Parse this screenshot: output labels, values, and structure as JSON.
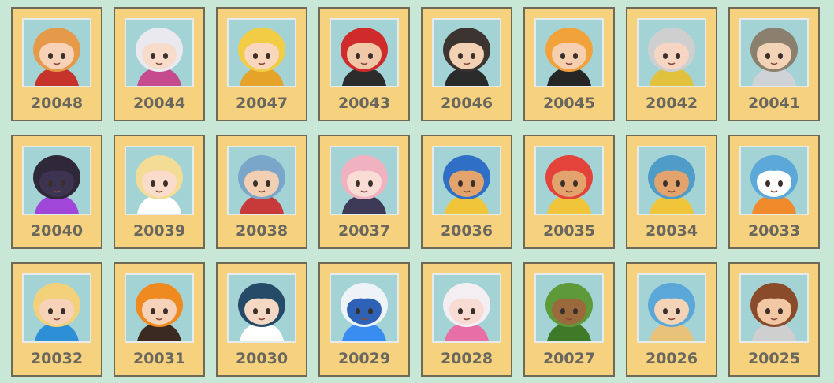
{
  "grid": {
    "items": [
      {
        "id": "20048",
        "icon": "chibi-girl-orange-hair-icon",
        "hair": "#e59a4a",
        "skin": "#f7d2b7",
        "accent": "#c5332a"
      },
      {
        "id": "20044",
        "icon": "chibi-white-hair-cap-icon",
        "hair": "#e9e9ef",
        "skin": "#f8dccb",
        "accent": "#c54a8e"
      },
      {
        "id": "20047",
        "icon": "chibi-yellow-costume-icon",
        "hair": "#f2cc45",
        "skin": "#f9d7bd",
        "accent": "#e6a32a"
      },
      {
        "id": "20043",
        "icon": "chibi-red-armor-icon",
        "hair": "#cf2b2b",
        "skin": "#f0c8a8",
        "accent": "#2c2c2c"
      },
      {
        "id": "20046",
        "icon": "chibi-dark-hat-boy-icon",
        "hair": "#3b3431",
        "skin": "#f2d1b5",
        "accent": "#2a2a2a"
      },
      {
        "id": "20045",
        "icon": "chibi-orange-ninja-icon",
        "hair": "#f1a23b",
        "skin": "#f6cfb0",
        "accent": "#262626"
      },
      {
        "id": "20042",
        "icon": "chibi-silver-hair-eyepatch-icon",
        "hair": "#cfcfcf",
        "skin": "#f6d6c3",
        "accent": "#e2c13c"
      },
      {
        "id": "20041",
        "icon": "chibi-armored-knight-icon",
        "hair": "#8b7f6e",
        "skin": "#f2d3b8",
        "accent": "#cfd2d6"
      },
      {
        "id": "20040",
        "icon": "chibi-dark-robot-icon",
        "hair": "#2e2838",
        "skin": "#3c3450",
        "accent": "#a047d9"
      },
      {
        "id": "20039",
        "icon": "chibi-blonde-laurel-icon",
        "hair": "#f3dc96",
        "skin": "#f9ddca",
        "accent": "#ffffff"
      },
      {
        "id": "20038",
        "icon": "chibi-armored-general-icon",
        "hair": "#7aa6c9",
        "skin": "#f2cfb2",
        "accent": "#c83a3a"
      },
      {
        "id": "20037",
        "icon": "chibi-pink-hair-girl-icon",
        "hair": "#f0b1c0",
        "skin": "#f9dcd3",
        "accent": "#3c3a56"
      },
      {
        "id": "20036",
        "icon": "chibi-blue-fish-hood-icon",
        "hair": "#2f6fc5",
        "skin": "#e2a36c",
        "accent": "#f0c53a"
      },
      {
        "id": "20035",
        "icon": "chibi-red-fish-hood-icon",
        "hair": "#e3433a",
        "skin": "#e2a36c",
        "accent": "#f0c53a"
      },
      {
        "id": "20034",
        "icon": "chibi-teal-fish-hood-icon",
        "hair": "#4e9cc7",
        "skin": "#e2a36c",
        "accent": "#f0c53a"
      },
      {
        "id": "20033",
        "icon": "chibi-snowman-icon",
        "hair": "#5ba8d9",
        "skin": "#ffffff",
        "accent": "#f08a2a"
      },
      {
        "id": "20032",
        "icon": "chibi-mermaid-blonde-icon",
        "hair": "#f3d07a",
        "skin": "#f6d2b8",
        "accent": "#2d8fd6"
      },
      {
        "id": "20031",
        "icon": "chibi-pumpkin-head-icon",
        "hair": "#ef8a20",
        "skin": "#f6d2b8",
        "accent": "#3b2a20"
      },
      {
        "id": "20030",
        "icon": "chibi-dark-hair-white-rabbit-icon",
        "hair": "#264b68",
        "skin": "#f4d8c4",
        "accent": "#ffffff"
      },
      {
        "id": "20029",
        "icon": "chibi-white-mecha-icon",
        "hair": "#eef3f8",
        "skin": "#2e62b6",
        "accent": "#3a8df0"
      },
      {
        "id": "20028",
        "icon": "chibi-white-hair-pink-ribbon-icon",
        "hair": "#f3eef2",
        "skin": "#f8dbd3",
        "accent": "#e86ea6"
      },
      {
        "id": "20027",
        "icon": "chibi-tree-sprite-icon",
        "hair": "#5e9a3a",
        "skin": "#9a6a3c",
        "accent": "#3f7a28"
      },
      {
        "id": "20026",
        "icon": "chibi-blue-shark-hood-icon",
        "hair": "#5aa7d8",
        "skin": "#f4d4b8",
        "accent": "#e9c27a"
      },
      {
        "id": "20025",
        "icon": "chibi-warrior-headband-icon",
        "hair": "#8a4b2a",
        "skin": "#f2c8a4",
        "accent": "#cfcfcf"
      }
    ]
  }
}
